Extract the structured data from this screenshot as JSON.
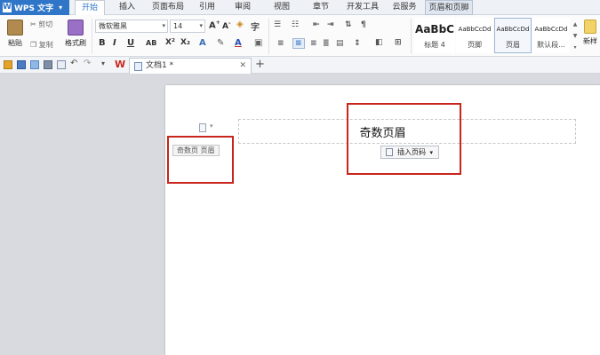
{
  "app": {
    "name": "WPS 文字"
  },
  "menu_tabs": [
    {
      "label": "开始"
    },
    {
      "label": "插入"
    },
    {
      "label": "页面布局"
    },
    {
      "label": "引用"
    },
    {
      "label": "审阅"
    },
    {
      "label": "视图"
    },
    {
      "label": "章节"
    },
    {
      "label": "开发工具"
    },
    {
      "label": "云服务"
    },
    {
      "label": "页眉和页脚"
    }
  ],
  "ribbon": {
    "paste_label": "粘贴",
    "cut_label": "剪切",
    "copy_label": "复制",
    "format_painter_label": "格式刷",
    "font_name": "微软雅黑",
    "font_size": "14",
    "styles": [
      {
        "sample": "AaBbC",
        "label": "标题 4"
      },
      {
        "sample": "AaBbCcDd",
        "label": "页脚"
      },
      {
        "sample": "AaBbCcDd",
        "label": "页眉"
      },
      {
        "sample": "AaBbCcDd",
        "label": "默认段..."
      }
    ],
    "new_style_label": "新样"
  },
  "doc_tab": {
    "title": "文档1 *"
  },
  "page": {
    "header_text": "奇数页眉",
    "insert_page_number_label": "插入页码",
    "odd_header_label": "奇数页 页眉"
  },
  "colors": {
    "accent": "#2f76c8",
    "highlight_box": "#c8251c"
  }
}
